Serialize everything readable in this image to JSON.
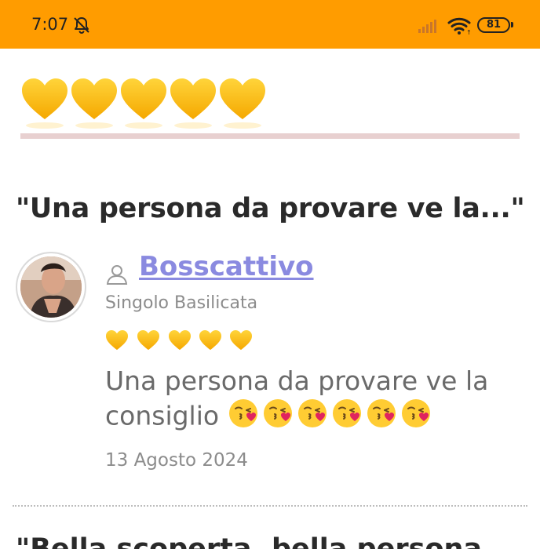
{
  "status_bar": {
    "time": "7:07",
    "battery": "81",
    "icons": [
      "bell-off-icon",
      "signal-icon",
      "wifi-icon",
      "battery-icon"
    ]
  },
  "overall_rating": {
    "hearts": 5,
    "max": 5,
    "icon": "yellow-heart-icon"
  },
  "review": {
    "title": "\"Una persona da provare ve la...\"",
    "user": {
      "name": "Bosscattivo",
      "location": "Singolo Basilicata",
      "icon": "user-icon"
    },
    "rating": {
      "hearts": 5,
      "max": 5
    },
    "text": "Una persona da provare ve la consiglio",
    "emoji_count": 6,
    "emoji": "kissing-face-heart-icon",
    "date": "13 Agosto 2024"
  },
  "next_review": {
    "title_partial": "\"Bella scoperta, bella persona"
  },
  "colors": {
    "status_bar": "#ff9c00",
    "username": "#8a8ae0",
    "heart": "#ffc21a",
    "divider": "#e8d0d0"
  }
}
